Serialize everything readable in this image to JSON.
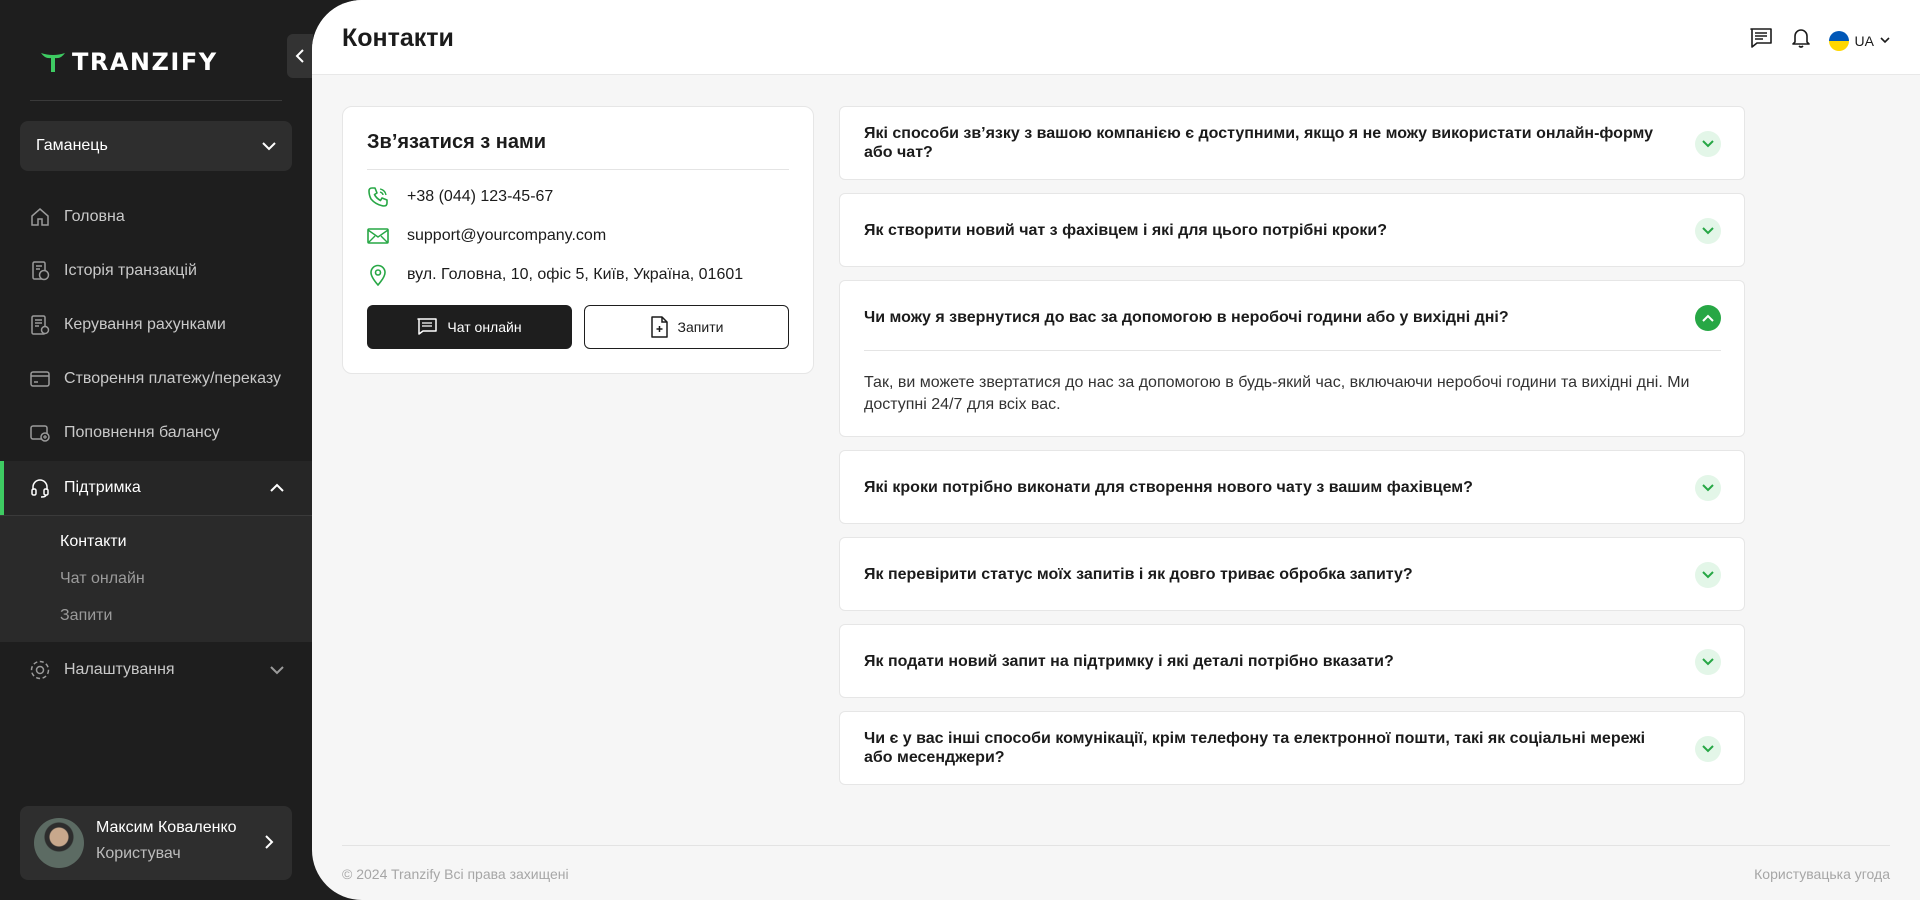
{
  "brand": {
    "name": "TRANZIFY",
    "accent": "#3ecb62"
  },
  "wallet": {
    "label": "Гаманець"
  },
  "nav": [
    {
      "label": "Головна",
      "icon": "home-icon"
    },
    {
      "label": "Історія транзакцій",
      "icon": "history-icon"
    },
    {
      "label": "Керування рахунками",
      "icon": "accounts-icon"
    },
    {
      "label": "Створення платежу/переказу",
      "icon": "payment-icon"
    },
    {
      "label": "Поповнення балансу",
      "icon": "topup-icon"
    },
    {
      "label": "Підтримка",
      "icon": "headset-icon",
      "expanded": true
    },
    {
      "label": "Налаштування",
      "icon": "settings-icon"
    }
  ],
  "support_sub": [
    "Контакти",
    "Чат онлайн",
    "Запити"
  ],
  "user": {
    "name": "Максим Коваленко",
    "role": "Користувач"
  },
  "page": {
    "title": "Контакти"
  },
  "topbar": {
    "lang": "UA"
  },
  "contact": {
    "title": "Зв’язатися з нами",
    "phone": "+38 (044) 123-45-67",
    "email": "support@yourcompany.com",
    "address": "вул. Головна, 10, офіс 5, Київ, Україна, 01601",
    "chat_button": "Чат онлайн",
    "requests_button": "Запити"
  },
  "faq": [
    {
      "q": "Які способи зв’язку з вашою компанією є доступними, якщо я не можу використати онлайн-форму або чат?",
      "open": false
    },
    {
      "q": "Як створити новий чат з фахівцем і які для цього потрібні кроки?",
      "open": false
    },
    {
      "q": "Чи можу я звернутися до вас за допомогою в неробочі години або у вихідні дні?",
      "open": true,
      "a": "Так, ви можете звертатися до нас за допомогою в будь-який час, включаючи неробочі години та вихідні дні. Ми доступні 24/7 для всіх вас."
    },
    {
      "q": "Які кроки потрібно виконати для створення нового чату з вашим фахівцем?",
      "open": false
    },
    {
      "q": "Як перевірити статус моїх запитів і як довго триває обробка запиту?",
      "open": false
    },
    {
      "q": "Як подати новий запит на підтримку і які деталі потрібно вказати?",
      "open": false
    },
    {
      "q": "Чи є у вас інші способи комунікації, крім телефону та електронної пошти, такі як соціальні мережі або месенджери?",
      "open": false
    }
  ],
  "footer": {
    "copyright": "© 2024 Tranzify Всі права захищені",
    "terms": "Користувацька угода"
  }
}
